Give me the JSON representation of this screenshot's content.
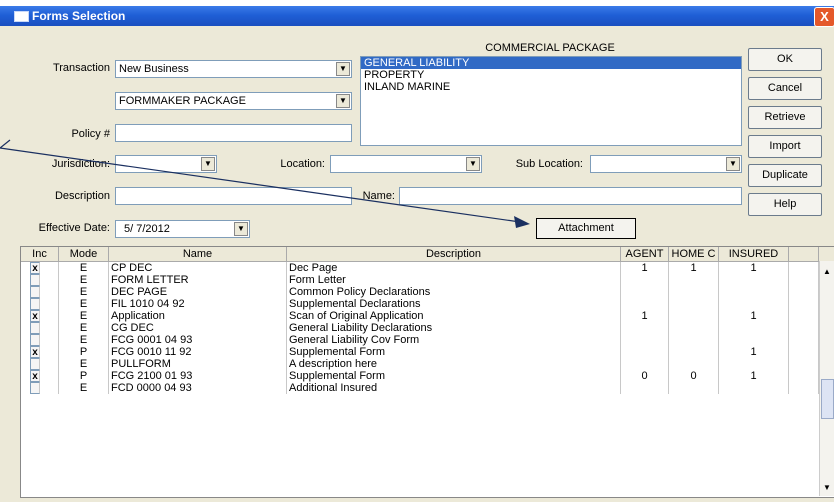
{
  "window": {
    "title": "Forms Selection",
    "close": "X"
  },
  "transaction": {
    "label": "Transaction",
    "value": "New Business"
  },
  "package": {
    "value": "FORMMAKER PACKAGE"
  },
  "policy": {
    "label": "Policy #",
    "value": ""
  },
  "jurisdiction": {
    "label": "Jurisdiction:",
    "value": ""
  },
  "location": {
    "label": "Location:",
    "value": ""
  },
  "sublocation": {
    "label": "Sub Location:",
    "value": ""
  },
  "description": {
    "label": "Description",
    "value": ""
  },
  "name": {
    "label": "Name:",
    "value": ""
  },
  "effective": {
    "label": "Effective Date:",
    "value": "5/ 7/2012"
  },
  "commercial": {
    "title": "COMMERCIAL PACKAGE",
    "items": [
      "GENERAL LIABILITY",
      "PROPERTY",
      "INLAND MARINE"
    ]
  },
  "buttons": {
    "ok": "OK",
    "cancel": "Cancel",
    "retrieve": "Retrieve",
    "import": "Import",
    "duplicate": "Duplicate",
    "help": "Help",
    "attachment": "Attachment"
  },
  "grid": {
    "headers": [
      "Inc",
      "Mode",
      "Name",
      "Description",
      "AGENT",
      "HOME C",
      "INSURED"
    ],
    "rows": [
      {
        "inc": "x",
        "mode": "E",
        "name": "CP DEC",
        "desc": "Dec Page",
        "agent": "1",
        "home": "1",
        "insured": "1"
      },
      {
        "inc": "",
        "mode": "E",
        "name": "FORM LETTER",
        "desc": "Form Letter",
        "agent": "",
        "home": "",
        "insured": ""
      },
      {
        "inc": "",
        "mode": "E",
        "name": "DEC PAGE",
        "desc": "Common Policy Declarations",
        "agent": "",
        "home": "",
        "insured": ""
      },
      {
        "inc": "",
        "mode": "E",
        "name": "FIL 1010 04 92",
        "desc": "Supplemental Declarations",
        "agent": "",
        "home": "",
        "insured": ""
      },
      {
        "inc": "x",
        "mode": "E",
        "name": "Application",
        "desc": "Scan of Original Application",
        "agent": "1",
        "home": "",
        "insured": "1"
      },
      {
        "inc": "",
        "mode": "E",
        "name": "CG DEC",
        "desc": "General Liability Declarations",
        "agent": "",
        "home": "",
        "insured": ""
      },
      {
        "inc": "",
        "mode": "E",
        "name": "FCG 0001 04 93",
        "desc": "General Liability Cov Form",
        "agent": "",
        "home": "",
        "insured": ""
      },
      {
        "inc": "x",
        "mode": "P",
        "name": "FCG 0010 11 92",
        "desc": "Supplemental Form",
        "agent": "",
        "home": "",
        "insured": "1"
      },
      {
        "inc": "",
        "mode": "E",
        "name": "PULLFORM",
        "desc": "A description here",
        "agent": "",
        "home": "",
        "insured": ""
      },
      {
        "inc": "x",
        "mode": "P",
        "name": "FCG 2100 01 93",
        "desc": "Supplemental Form",
        "agent": "0",
        "home": "0",
        "insured": "1"
      },
      {
        "inc": "",
        "mode": "E",
        "name": "FCD 0000 04 93",
        "desc": "Additional Insured",
        "agent": "",
        "home": "",
        "insured": ""
      }
    ]
  }
}
